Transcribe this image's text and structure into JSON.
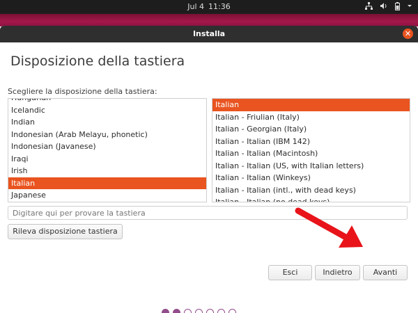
{
  "topbar": {
    "date": "Jul 4",
    "time": "11:36",
    "tray_icons": [
      "network-icon",
      "volume-icon",
      "battery-icon",
      "menu-arrow-icon"
    ]
  },
  "window": {
    "title": "Installa"
  },
  "page": {
    "title": "Disposizione della tastiera",
    "prompt": "Scegliere la disposizione della tastiera:"
  },
  "layouts": {
    "items": [
      {
        "label": "Hungarian"
      },
      {
        "label": "Icelandic"
      },
      {
        "label": "Indian"
      },
      {
        "label": "Indonesian (Arab Melayu, phonetic)"
      },
      {
        "label": "Indonesian (Javanese)"
      },
      {
        "label": "Iraqi"
      },
      {
        "label": "Irish"
      },
      {
        "label": "Italian"
      },
      {
        "label": "Japanese"
      }
    ],
    "selected": "Italian"
  },
  "variants": {
    "items": [
      {
        "label": "Italian"
      },
      {
        "label": "Italian - Friulian (Italy)"
      },
      {
        "label": "Italian - Georgian (Italy)"
      },
      {
        "label": "Italian - Italian (IBM 142)"
      },
      {
        "label": "Italian - Italian (Macintosh)"
      },
      {
        "label": "Italian - Italian (US, with Italian letters)"
      },
      {
        "label": "Italian - Italian (Winkeys)"
      },
      {
        "label": "Italian - Italian (intl., with dead keys)"
      },
      {
        "label": "Italian - Italian (no dead keys)"
      }
    ],
    "selected": "Italian"
  },
  "test_field": {
    "placeholder": "Digitare qui per provare la tastiera"
  },
  "buttons": {
    "detect": "Rileva disposizione tastiera",
    "quit": "Esci",
    "back": "Indietro",
    "next": "Avanti"
  },
  "progress": {
    "total_steps": 7,
    "completed_steps": 2
  },
  "colors": {
    "accent": "#e95420",
    "progress": "#924d8b",
    "annotation_arrow": "#e8141a"
  }
}
